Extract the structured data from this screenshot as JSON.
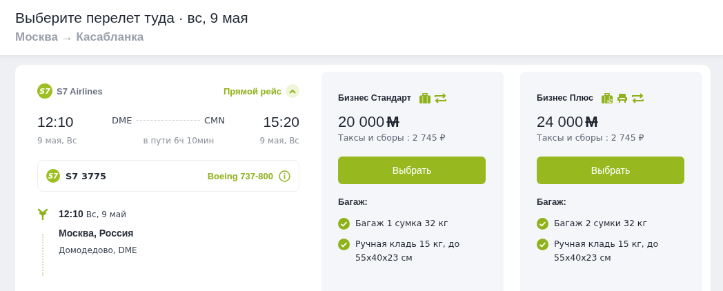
{
  "header": {
    "title": "Выберите перелет туда · вс, 9 мая",
    "route": "Москва → Касабланка"
  },
  "flight": {
    "airline": "S7 Airlines",
    "airline_logo": "S7",
    "direct_label": "Прямой рейс",
    "expanded": true,
    "departure": {
      "time": "12:10",
      "airport": "DME",
      "date": "9 мая, Вс"
    },
    "arrival": {
      "time": "15:20",
      "airport": "CMN",
      "date": "9 мая, Вс"
    },
    "duration": "в пути 6ч 10мин",
    "segment": {
      "logo": "S7",
      "number": "S7 3775",
      "aircraft": "Boeing 737-800"
    },
    "stops": [
      {
        "time": "12:10",
        "date": "Вс, 9 май",
        "city": "Москва, Россия",
        "airport": "Домодедово, DME"
      }
    ]
  },
  "fares": [
    {
      "name": "Бизнес Стандарт",
      "amenities": [
        {
          "kind": "baggage"
        },
        {
          "kind": "exchange"
        }
      ],
      "price": "20 000",
      "currency": "M",
      "taxes": "Таксы и сборы : 2 745 ₽",
      "button": "Выбрать",
      "baggage_title": "Багаж:",
      "baggage": [
        {
          "text": "Багаж 1 сумка 32 кг",
          "included": true
        },
        {
          "text": "Ручная кладь 15 кг, до 55x40x23 см",
          "included": true
        }
      ]
    },
    {
      "name": "Бизнес Плюс",
      "amenities": [
        {
          "kind": "baggage",
          "badge": "x2"
        },
        {
          "kind": "seat"
        },
        {
          "kind": "exchange"
        }
      ],
      "price": "24 000",
      "currency": "M",
      "taxes": "Таксы и сборы : 2 745 ₽",
      "button": "Выбрать",
      "baggage_title": "Багаж:",
      "baggage": [
        {
          "text": "Багаж 2 сумки 32 кг",
          "included": true
        },
        {
          "text": "Ручная кладь 15 кг, до 55x40x23 см",
          "included": true
        }
      ]
    }
  ]
}
